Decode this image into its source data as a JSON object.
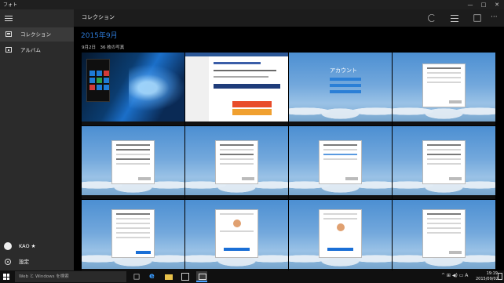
{
  "app": {
    "title": "フォト",
    "window_controls": [
      "—",
      "□",
      "✕"
    ]
  },
  "sidebar": {
    "items": [
      {
        "label": "コレクション",
        "icon": "collection-icon",
        "active": true
      },
      {
        "label": "アルバム",
        "icon": "album-icon",
        "active": false
      }
    ],
    "user": {
      "name": "KAO ★"
    },
    "settings_label": "設定"
  },
  "header": {
    "title": "コレクション",
    "tools": [
      "refresh-icon",
      "select-icon",
      "slideshow-icon",
      "more-icon"
    ],
    "more_glyph": "···"
  },
  "main": {
    "month": "2015年9月",
    "date_line": "9月2日　36 枚の写真"
  },
  "thumbnails": [
    {
      "kind": "win10-desktop"
    },
    {
      "kind": "web-page"
    },
    {
      "kind": "account-login"
    },
    {
      "kind": "dialog"
    },
    {
      "kind": "dialog"
    },
    {
      "kind": "dialog"
    },
    {
      "kind": "dialog"
    },
    {
      "kind": "dialog"
    },
    {
      "kind": "dialog"
    },
    {
      "kind": "google-signin"
    },
    {
      "kind": "google-signin"
    },
    {
      "kind": "dialog"
    }
  ],
  "account_title": "アカウント",
  "taskbar": {
    "search_placeholder": "Web と Windows を検索",
    "time": "19:19",
    "date": "2015/09/02",
    "tray_glyphs": "^  ⊞  ◀)  ▭  A"
  },
  "colors": {
    "accent": "#2d7ad6",
    "sidebar_bg": "#2b2b2b",
    "header_bg": "#1c1c1c"
  }
}
